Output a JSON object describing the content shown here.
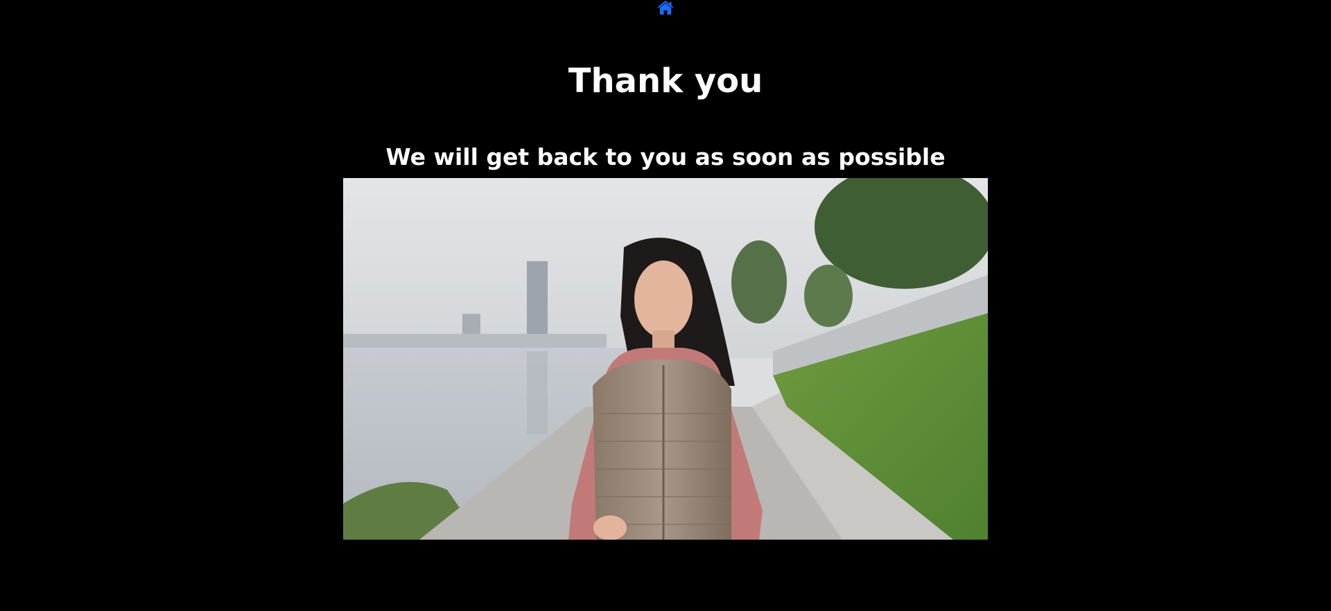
{
  "nav": {
    "home_icon": "home-icon",
    "home_color": "#1a6cff"
  },
  "content": {
    "title": "Thank you",
    "subtitle": "We will get back to you as soon as possible"
  },
  "hero_image": {
    "subject": "woman-jogging-by-river-photo"
  },
  "colors": {
    "background": "#000000",
    "text": "#ffffff"
  }
}
